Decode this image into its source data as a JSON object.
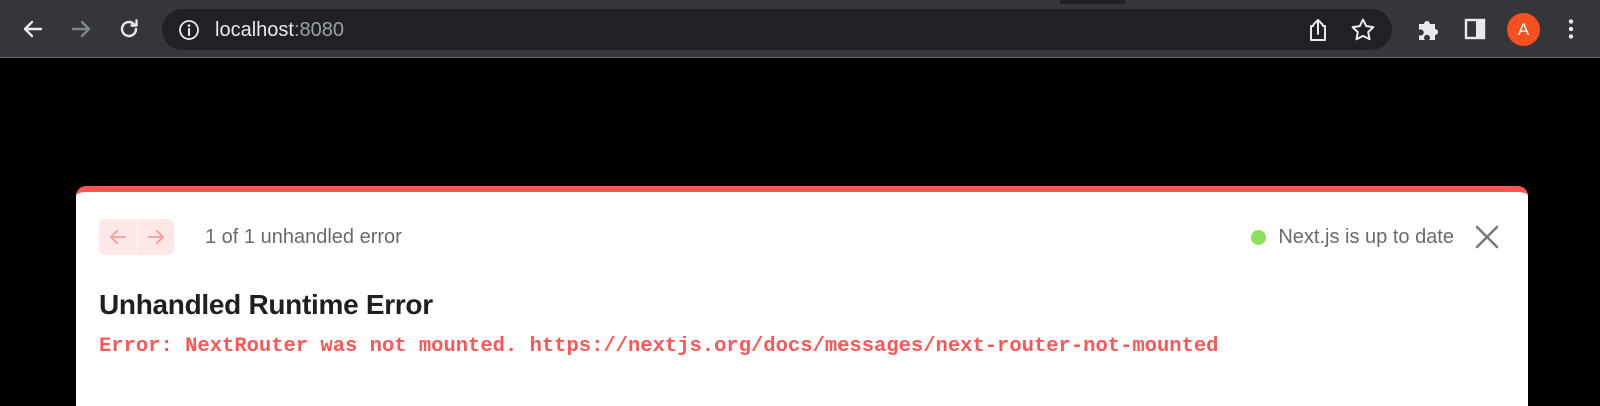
{
  "browser": {
    "url_host": "localhost",
    "url_port": ":8080",
    "profile_initial": "A",
    "icons": {
      "back": "arrow-left-icon",
      "forward": "arrow-right-icon",
      "reload": "reload-icon",
      "site_info": "info-icon",
      "share": "share-icon",
      "bookmark": "star-icon",
      "extensions": "puzzle-icon",
      "side_panel": "side-panel-icon",
      "menu": "kebab-menu-icon"
    },
    "colors": {
      "toolbar": "#35363a",
      "omnibox": "#202124",
      "avatar": "#f4511e"
    }
  },
  "error_overlay": {
    "pagination_text": "1 of 1 unhandled error",
    "status_text": "Next.js is up to date",
    "title": "Unhandled Runtime Error",
    "message": "Error: NextRouter was not mounted. https://nextjs.org/docs/messages/next-router-not-mounted",
    "icons": {
      "prev": "arrow-left-icon",
      "next": "arrow-right-icon",
      "close": "close-icon"
    },
    "colors": {
      "accent": "#ff5555",
      "status_dot": "#8ce05a",
      "nav_bg": "#fde7e7"
    }
  }
}
